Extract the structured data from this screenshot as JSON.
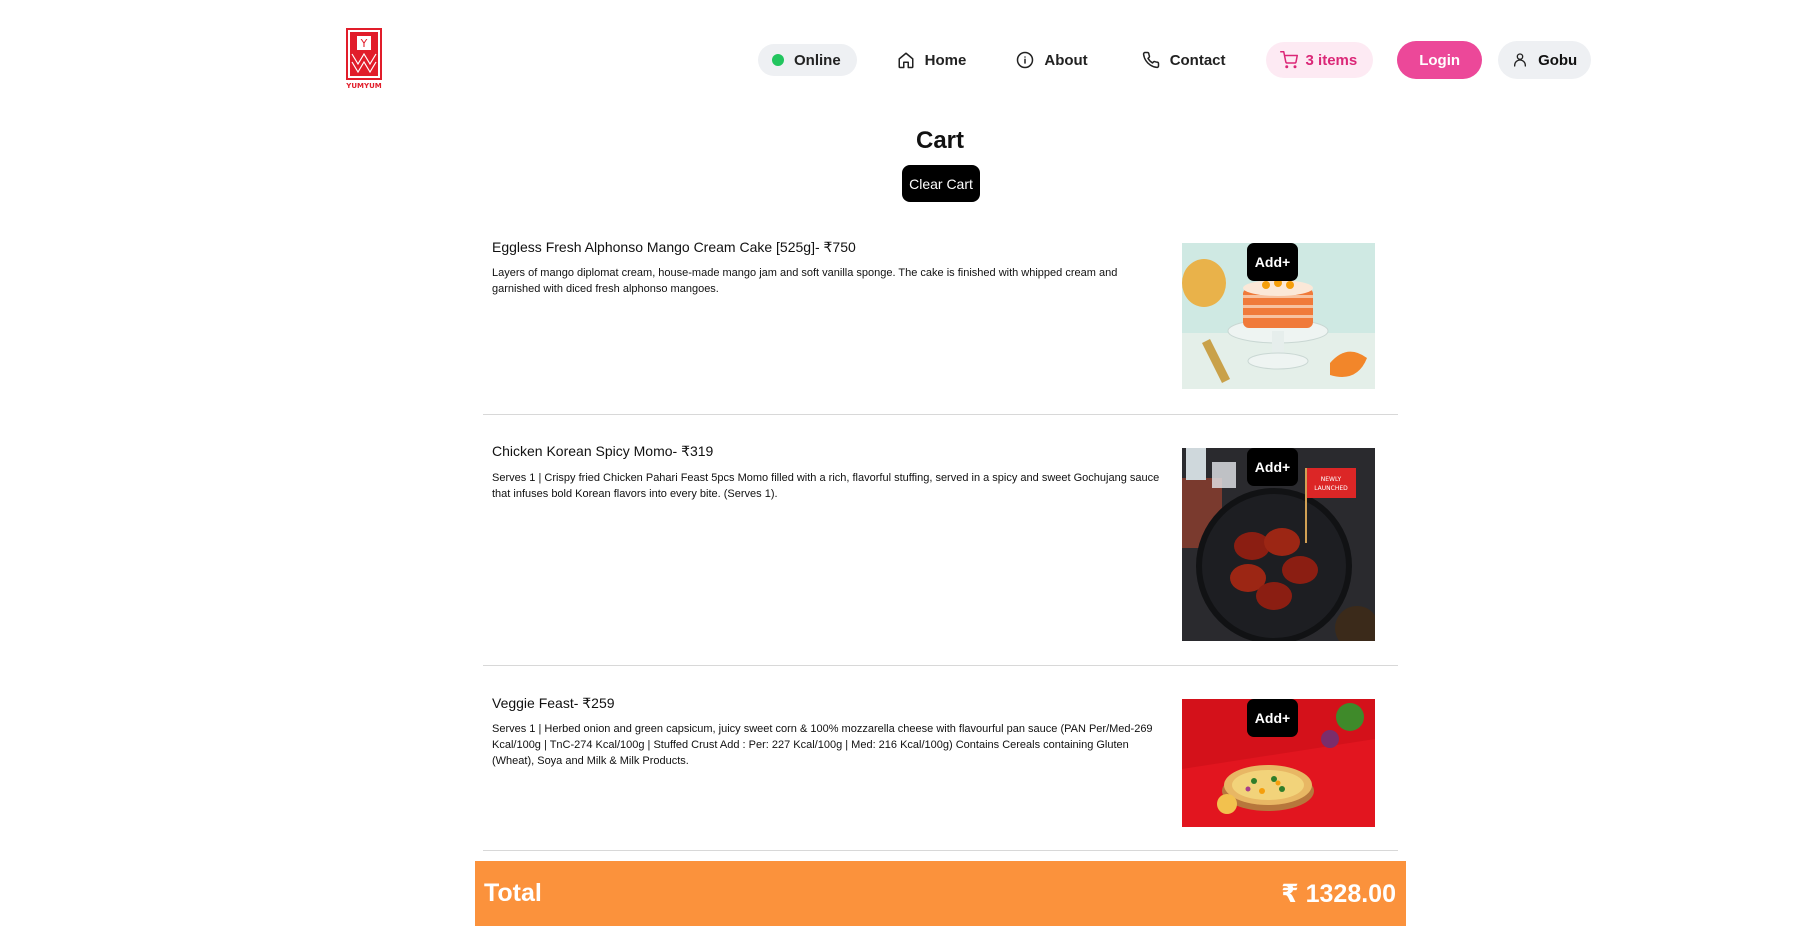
{
  "header": {
    "logo_text": "YUMYUM",
    "logo_letter": "Y",
    "status_label": "Online",
    "nav": {
      "home": "Home",
      "about": "About",
      "contact": "Contact"
    },
    "cart_label": "3 items",
    "login_label": "Login",
    "user_name": "Gobu"
  },
  "cart": {
    "title": "Cart",
    "clear_label": "Clear Cart",
    "items": [
      {
        "name": "Eggless Fresh Alphonso Mango Cream Cake [525g]- ₹750",
        "description": "Layers of mango diplomat cream, house-made mango jam and soft vanilla sponge. The cake is finished with whipped cream and garnished with diced fresh alphonso mangoes.",
        "add_label": "Add+"
      },
      {
        "name": "Chicken Korean Spicy Momo- ₹319",
        "description": "Serves 1 | Crispy fried Chicken Pahari Feast 5pcs Momo filled with a rich, flavorful stuffing, served in a spicy and sweet Gochujang sauce that infuses bold Korean flavors into every bite. (Serves 1).",
        "add_label": "Add+",
        "badge_line1": "NEWLY",
        "badge_line2": "LAUNCHED"
      },
      {
        "name": "Veggie Feast- ₹259",
        "description": "Serves 1 | Herbed onion and green capsicum, juicy sweet corn & 100% mozzarella cheese with flavourful pan sauce (PAN Per/Med-269 Kcal/100g | TnC-274 Kcal/100g | Stuffed Crust Add : Per: 227 Kcal/100g | Med: 216 Kcal/100g) Contains Cereals containing Gluten (Wheat), Soya and Milk & Milk Products.",
        "add_label": "Add+"
      }
    ],
    "total_label": "Total",
    "total_value": "₹ 1328.00"
  },
  "colors": {
    "accent_pink": "#ec4899",
    "total_orange": "#fb923c",
    "online_green": "#22c55e",
    "logo_red": "#e11d2a"
  }
}
